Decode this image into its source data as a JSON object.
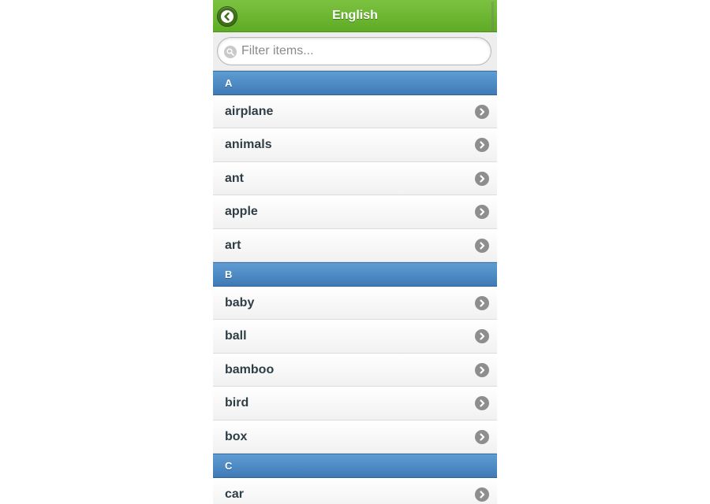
{
  "header": {
    "title": "English"
  },
  "filter": {
    "placeholder": "Filter items..."
  },
  "sections": [
    {
      "letter": "A",
      "items": [
        {
          "label": "airplane"
        },
        {
          "label": "animals"
        },
        {
          "label": "ant"
        },
        {
          "label": "apple"
        },
        {
          "label": "art"
        }
      ]
    },
    {
      "letter": "B",
      "items": [
        {
          "label": "baby"
        },
        {
          "label": "ball"
        },
        {
          "label": "bamboo"
        },
        {
          "label": "bird"
        },
        {
          "label": "box"
        }
      ]
    },
    {
      "letter": "C",
      "items": [
        {
          "label": "car"
        }
      ]
    }
  ],
  "colors": {
    "header": "#6ab82f",
    "divider": "#4a86c2",
    "item_text": "#2f3e46"
  },
  "icons": {
    "back": "back-arrow-icon",
    "search": "search-icon",
    "item_arrow": "chevron-right-icon"
  }
}
